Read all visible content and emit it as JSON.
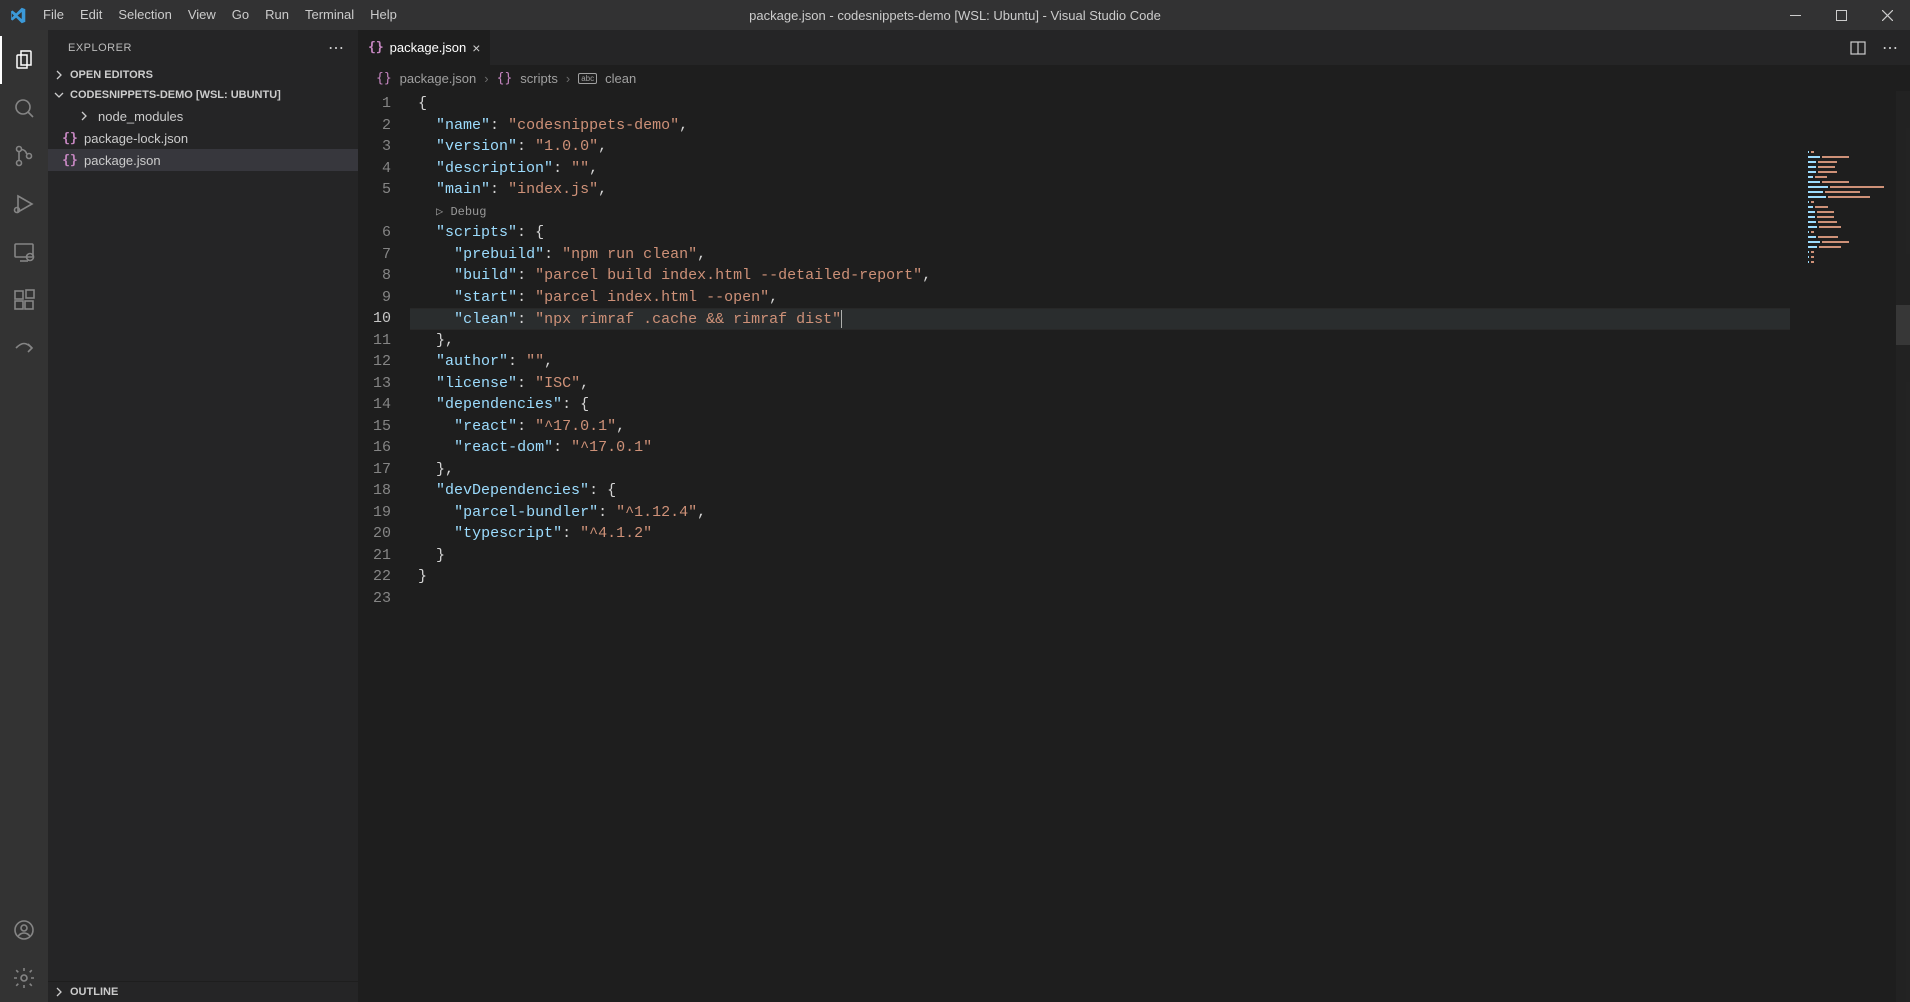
{
  "titlebar": {
    "title": "package.json - codesnippets-demo [WSL: Ubuntu] - Visual Studio Code",
    "menu": [
      "File",
      "Edit",
      "Selection",
      "View",
      "Go",
      "Run",
      "Terminal",
      "Help"
    ]
  },
  "sidebar": {
    "title": "EXPLORER",
    "sections": {
      "open_editors": "OPEN EDITORS",
      "project": "CODESNIPPETS-DEMO [WSL: UBUNTU]",
      "outline": "OUTLINE"
    },
    "tree": [
      {
        "label": "node_modules",
        "kind": "folder"
      },
      {
        "label": "package-lock.json",
        "kind": "json"
      },
      {
        "label": "package.json",
        "kind": "json",
        "selected": true
      }
    ]
  },
  "tabs": {
    "active": {
      "label": "package.json",
      "icon": "json"
    }
  },
  "breadcrumbs": [
    {
      "icon": "json",
      "label": "package.json"
    },
    {
      "icon": "json",
      "label": "scripts"
    },
    {
      "icon": "abc",
      "label": "clean"
    }
  ],
  "codelens": {
    "debug": "Debug"
  },
  "editor": {
    "active_line": 10,
    "lines": [
      "{",
      "  \"name\": \"codesnippets-demo\",",
      "  \"version\": \"1.0.0\",",
      "  \"description\": \"\",",
      "  \"main\": \"index.js\",",
      "  \"scripts\": {",
      "    \"prebuild\": \"npm run clean\",",
      "    \"build\": \"parcel build index.html --detailed-report\",",
      "    \"start\": \"parcel index.html --open\",",
      "    \"clean\": \"npx rimraf .cache && rimraf dist\"",
      "  },",
      "  \"author\": \"\",",
      "  \"license\": \"ISC\",",
      "  \"dependencies\": {",
      "    \"react\": \"^17.0.1\",",
      "    \"react-dom\": \"^17.0.1\"",
      "  },",
      "  \"devDependencies\": {",
      "    \"parcel-bundler\": \"^1.12.4\",",
      "    \"typescript\": \"^4.1.2\"",
      "  }",
      "}",
      ""
    ]
  },
  "colors": {
    "key": "#9cdcfe",
    "string": "#ce9178",
    "punct": "#d4d4d4"
  }
}
